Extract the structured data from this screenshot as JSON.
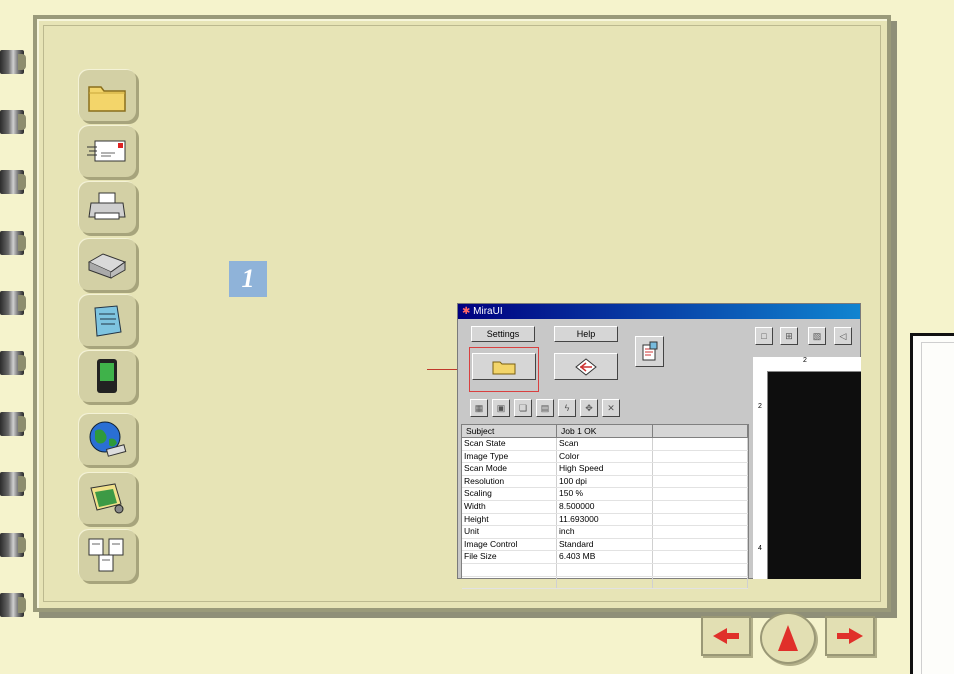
{
  "sidebar": {
    "icons": [
      {
        "name": "folder-icon"
      },
      {
        "name": "email-icon"
      },
      {
        "name": "printer-icon"
      },
      {
        "name": "fax-icon"
      },
      {
        "name": "notepad-icon"
      },
      {
        "name": "pda-icon"
      },
      {
        "name": "web-globe-icon"
      },
      {
        "name": "image-edit-icon"
      },
      {
        "name": "document-copy-icon"
      }
    ]
  },
  "step": {
    "number": "1"
  },
  "app_window": {
    "title": "MiraUI",
    "settings_label": "Settings",
    "help_label": "Help",
    "table": {
      "headers": [
        "Subject",
        "Job 1    OK",
        ""
      ],
      "rows": [
        [
          "Scan State",
          "Scan"
        ],
        [
          "Image Type",
          "Color"
        ],
        [
          "Scan Mode",
          "High Speed"
        ],
        [
          "Resolution",
          "100 dpi"
        ],
        [
          "Scaling",
          "150 %"
        ],
        [
          "Width",
          "8.500000"
        ],
        [
          "Height",
          "11.693000"
        ],
        [
          "Unit",
          "inch"
        ],
        [
          "Image Control",
          "Standard"
        ],
        [
          "File Size",
          "6.403   MB"
        ],
        [
          "",
          ""
        ],
        [
          "",
          ""
        ]
      ]
    },
    "ruler": {
      "top_mark": "2",
      "left_marks": [
        "2",
        "4"
      ]
    }
  },
  "nav": {
    "prev": "previous-page",
    "home": "home",
    "next": "next-page"
  },
  "colors": {
    "background": "#f5f3cc",
    "notebook": "#e7e4b6",
    "step_badge": "#8fb3d9",
    "nav_arrow": "#e0302a",
    "highlight": "#d94040"
  }
}
